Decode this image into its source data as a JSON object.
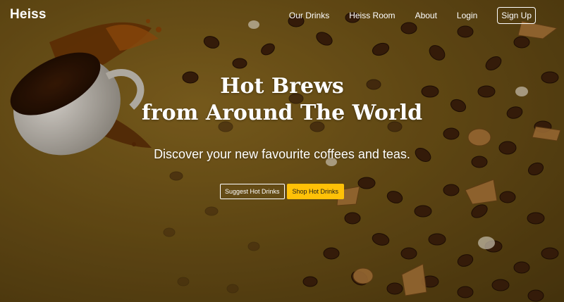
{
  "brand": "Heiss",
  "nav": {
    "items": [
      "Our Drinks",
      "Heiss Room",
      "About",
      "Login"
    ],
    "signup": "Sign Up"
  },
  "hero": {
    "title_line1": "Hot Brews",
    "title_line2": "from Around The World",
    "subtitle": "Discover your new favourite coffees and teas.",
    "cta_primary": "Suggest Hot Drinks",
    "cta_secondary": "Shop Hot Drinks"
  },
  "colors": {
    "background": "#6f5418",
    "accent": "#ffc107",
    "text": "#ffffff"
  }
}
